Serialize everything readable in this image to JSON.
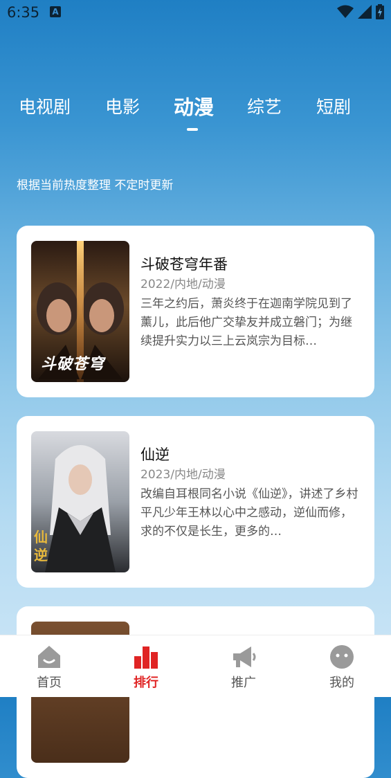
{
  "status": {
    "time": "6:35",
    "notification_letter": "A"
  },
  "tabs": [
    {
      "label": "电视剧"
    },
    {
      "label": "电影"
    },
    {
      "label": "动漫"
    },
    {
      "label": "综艺"
    },
    {
      "label": "短剧"
    }
  ],
  "active_tab": "动漫",
  "subtitle": "根据当前热度整理 不定时更新",
  "cards": [
    {
      "title": "斗破苍穹年番",
      "meta": "2022/内地/动漫",
      "description": "三年之约后，萧炎终于在迦南学院见到了薰儿，此后他广交挚友并成立磐门；为继续提升实力以三上云岚宗为目标…",
      "poster_title": "斗破苍穹"
    },
    {
      "title": "仙逆",
      "meta": "2023/内地/动漫",
      "description": "改编自耳根同名小说《仙逆》，讲述了乡村平凡少年王林以心中之感动，逆仙而修，求的不仅是长生，更多的…",
      "poster_title": "仙逆"
    }
  ],
  "nav": [
    {
      "label": "首页",
      "icon": "home-icon"
    },
    {
      "label": "排行",
      "icon": "ranking-icon"
    },
    {
      "label": "推广",
      "icon": "megaphone-icon"
    },
    {
      "label": "我的",
      "icon": "profile-icon"
    }
  ],
  "colors": {
    "accent": "#e02424",
    "nav_inactive": "#9a9a9a"
  }
}
